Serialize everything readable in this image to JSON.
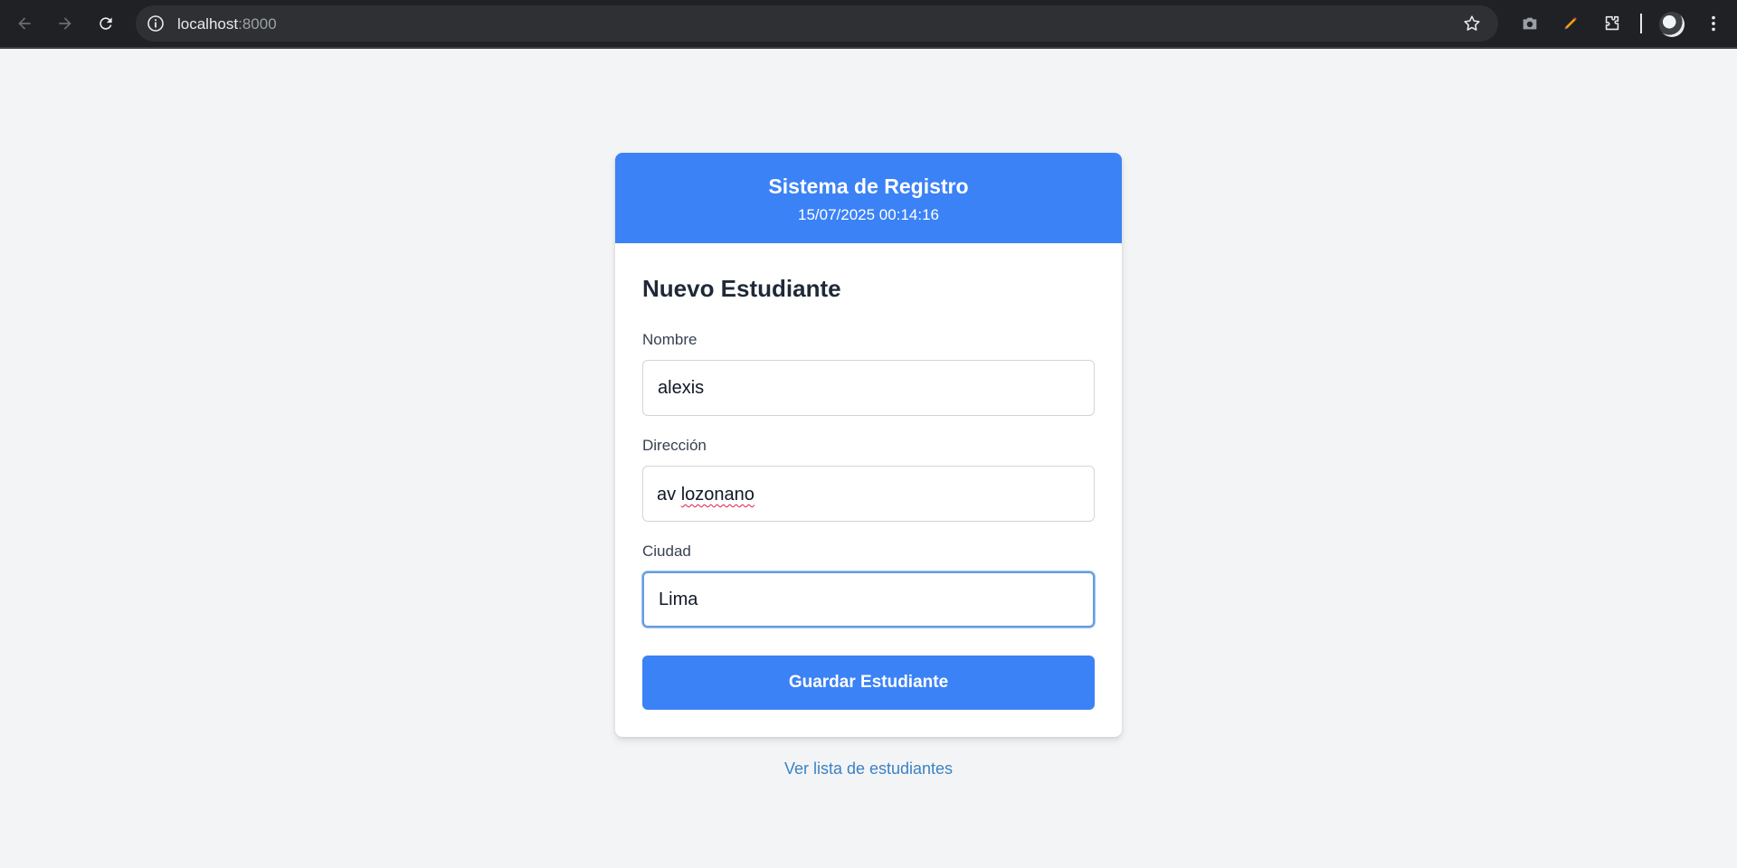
{
  "browser": {
    "url_host": "localhost",
    "url_port": ":8000"
  },
  "header": {
    "title": "Sistema de Registro",
    "datetime": "15/07/2025 00:14:16"
  },
  "form": {
    "heading": "Nuevo Estudiante",
    "fields": [
      {
        "label": "Nombre",
        "value": "alexis"
      },
      {
        "label": "Dirección",
        "value_prefix": "av ",
        "value_misspelled": "lozonano"
      },
      {
        "label": "Ciudad",
        "value": "Lima"
      }
    ],
    "submit_label": "Guardar Estudiante"
  },
  "footer": {
    "link_label": "Ver lista de estudiantes"
  },
  "colors": {
    "accent": "#3b82f6",
    "page_bg": "#f3f4f6",
    "link": "#3b82c4"
  }
}
